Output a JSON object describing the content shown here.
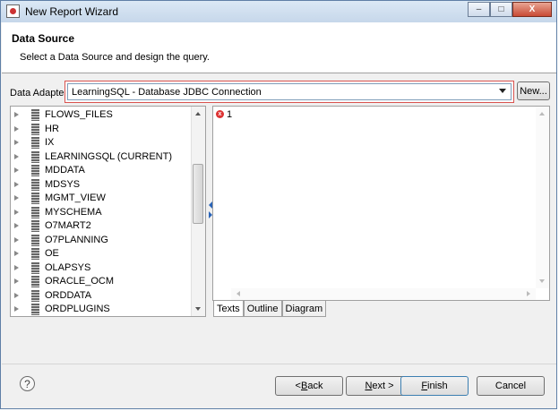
{
  "window": {
    "title": "New Report Wizard",
    "buttons": {
      "minimize": "–",
      "maximize": "□",
      "close": "X"
    }
  },
  "header": {
    "title": "Data Source",
    "description": "Select a Data Source and design the query."
  },
  "adapter": {
    "label": "Data Adapter",
    "selected": "LearningSQL - Database JDBC Connection",
    "new_button": "New..."
  },
  "tree": {
    "items": [
      "FLOWS_FILES",
      "HR",
      "IX",
      "LEARNINGSQL (CURRENT)",
      "MDDATA",
      "MDSYS",
      "MGMT_VIEW",
      "MYSCHEMA",
      "O7MART2",
      "O7PLANNING",
      "OE",
      "OLAPSYS",
      "ORACLE_OCM",
      "ORDDATA",
      "ORDPLUGINS"
    ]
  },
  "editor": {
    "line_number": "1",
    "tabs": [
      "Texts",
      "Outline",
      "Diagram"
    ]
  },
  "footer": {
    "help": "?",
    "back": {
      "prefix": "< ",
      "mnemonic": "B",
      "rest": "ack"
    },
    "next": {
      "mnemonic": "N",
      "rest": "ext >"
    },
    "finish": {
      "mnemonic": "F",
      "rest": "inish"
    },
    "cancel": "Cancel"
  }
}
